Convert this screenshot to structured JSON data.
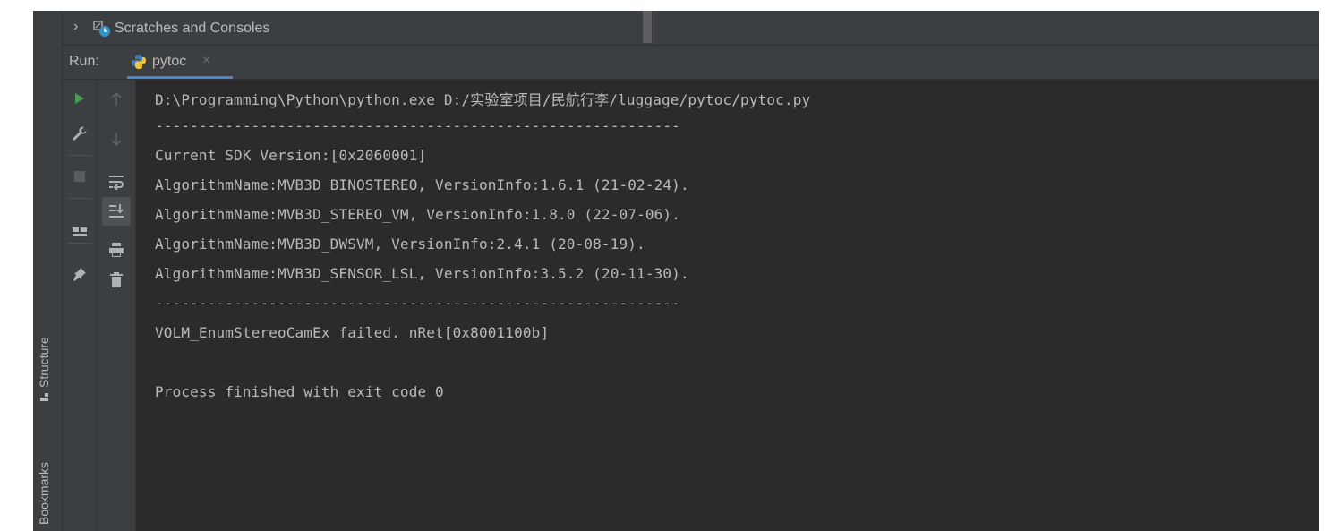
{
  "left_strip": {
    "structure_label": "Structure",
    "bookmarks_label": "Bookmarks"
  },
  "project_tree": {
    "expand_icon": "chevron-right-icon",
    "item_icon": "scratches-icon",
    "item_label": "Scratches and Consoles"
  },
  "run_panel": {
    "label": "Run:",
    "tab": {
      "icon": "python-icon",
      "label": "pytoc",
      "close": "×"
    }
  },
  "toolbar_left": [
    "run-icon",
    "wrench-icon",
    "stop-icon",
    "layout-icon",
    "pin-icon"
  ],
  "toolbar_right": [
    "up-arrow-icon",
    "down-arrow-icon",
    "soft-wrap-icon",
    "scroll-to-end-icon",
    "print-icon",
    "trash-icon"
  ],
  "console": {
    "lines": [
      "D:\\Programming\\Python\\python.exe D:/实验室项目/民航行李/luggage/pytoc/pytoc.py",
      "------------------------------------------------------------",
      "Current SDK Version:[0x2060001]",
      "AlgorithmName:MVB3D_BINOSTEREO, VersionInfo:1.6.1 (21-02-24).",
      "AlgorithmName:MVB3D_STEREO_VM, VersionInfo:1.8.0 (22-07-06).",
      "AlgorithmName:MVB3D_DWSVM, VersionInfo:2.4.1 (20-08-19).",
      "AlgorithmName:MVB3D_SENSOR_LSL, VersionInfo:3.5.2 (20-11-30).",
      "------------------------------------------------------------",
      "VOLM_EnumStereoCamEx failed. nRet[0x8001100b]",
      "",
      "Process finished with exit code 0"
    ]
  },
  "colors": {
    "panel_bg": "#3c3f41",
    "editor_bg": "#2b2b2b",
    "text": "#bbbbbb",
    "run_green": "#499c54",
    "tab_accent": "#4a88c7"
  }
}
